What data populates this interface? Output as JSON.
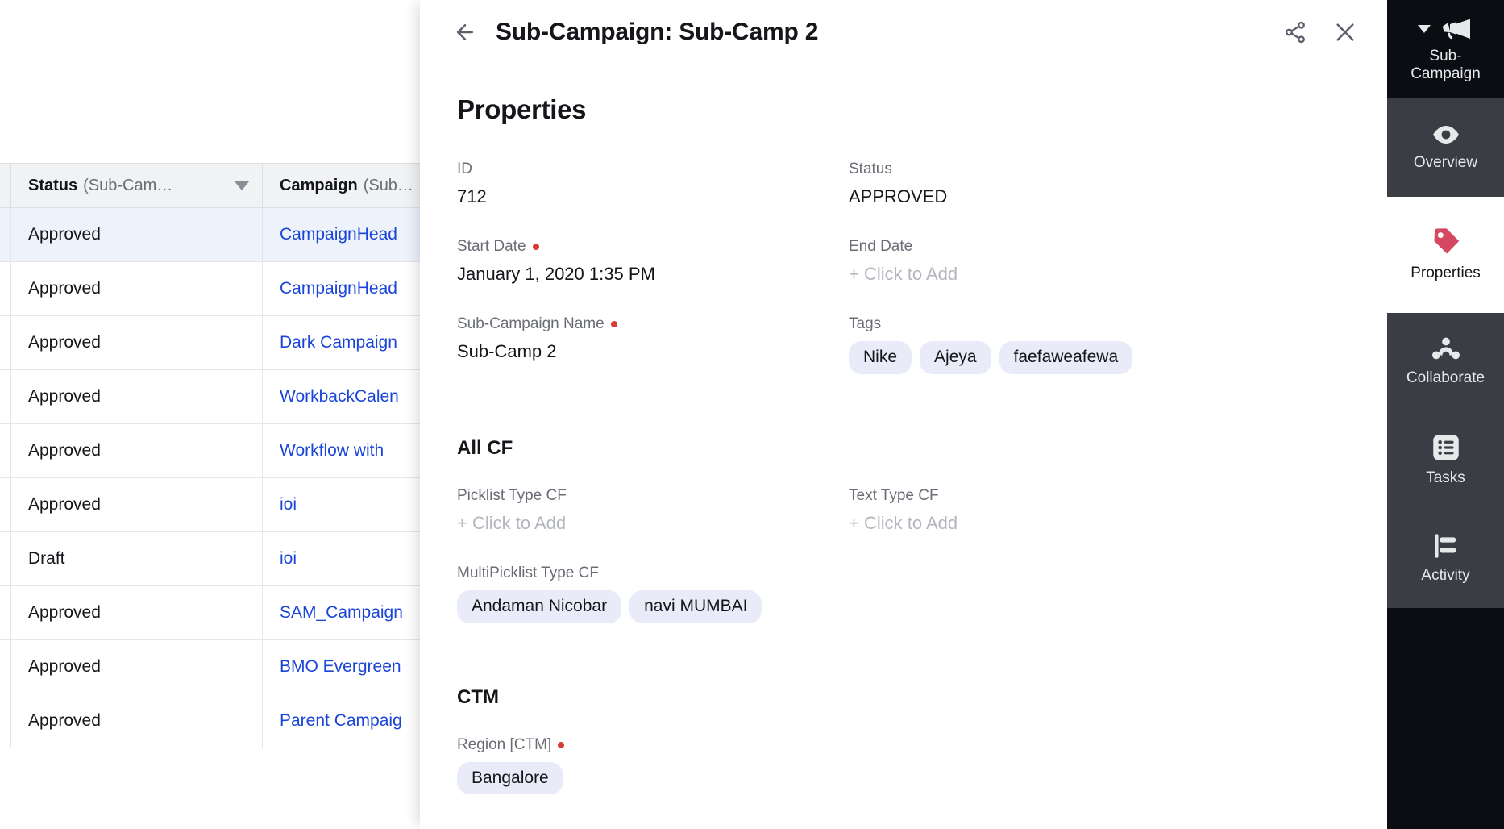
{
  "table": {
    "columns": [
      {
        "name": "Status",
        "qualifier": "(Sub-Cam…",
        "has_sort_caret": true
      },
      {
        "name": "Campaign",
        "qualifier": "(Sub…",
        "has_sort_caret": false
      }
    ],
    "rows": [
      {
        "status": "Approved",
        "campaign": "CampaignHead",
        "selected": true
      },
      {
        "status": "Approved",
        "campaign": "CampaignHead",
        "selected": false
      },
      {
        "status": "Approved",
        "campaign": "Dark Campaign",
        "selected": false
      },
      {
        "status": "Approved",
        "campaign": "WorkbackCalen",
        "selected": false
      },
      {
        "status": "Approved",
        "campaign": "Workflow with ",
        "selected": false
      },
      {
        "status": "Approved",
        "campaign": "ioi",
        "selected": false
      },
      {
        "status": "Draft",
        "campaign": "ioi",
        "selected": false
      },
      {
        "status": "Approved",
        "campaign": "SAM_Campaign",
        "selected": false
      },
      {
        "status": "Approved",
        "campaign": "BMO Evergreen",
        "selected": false
      },
      {
        "status": "Approved",
        "campaign": "Parent Campaig",
        "selected": false
      }
    ]
  },
  "panel": {
    "back_icon": "arrow-left-icon",
    "title": "Sub-Campaign: Sub-Camp 2",
    "share_icon": "share-icon",
    "close_icon": "close-icon",
    "sections": {
      "properties": {
        "heading": "Properties",
        "fields": {
          "id": {
            "label": "ID",
            "value": "712",
            "required": false
          },
          "status": {
            "label": "Status",
            "value": "APPROVED",
            "required": false
          },
          "start_date": {
            "label": "Start Date",
            "value": "January 1, 2020 1:35 PM",
            "required": true
          },
          "end_date": {
            "label": "End Date",
            "value": "+ Click to Add",
            "required": false,
            "empty": true
          },
          "sub_campaign_name": {
            "label": "Sub-Campaign Name",
            "value": "Sub-Camp 2",
            "required": true
          },
          "tags": {
            "label": "Tags",
            "required": false,
            "pills": [
              "Nike",
              "Ajeya",
              "faefaweafewa"
            ]
          }
        }
      },
      "all_cf": {
        "heading": "All CF",
        "fields": {
          "picklist": {
            "label": "Picklist Type CF",
            "value": "+ Click to Add",
            "required": false,
            "empty": true
          },
          "text": {
            "label": "Text Type CF",
            "value": "+ Click to Add",
            "required": false,
            "empty": true
          },
          "multipicklist": {
            "label": "MultiPicklist Type CF",
            "required": false,
            "pills": [
              "Andaman Nicobar",
              "navi MUMBAI"
            ]
          }
        }
      },
      "ctm": {
        "heading": "CTM",
        "fields": {
          "region": {
            "label": "Region [CTM]",
            "required": true,
            "pills": [
              "Bangalore"
            ]
          }
        }
      }
    }
  },
  "rail": {
    "items": [
      {
        "label": "Sub-\nCampaign",
        "icon": "megaphone-icon",
        "state": "brand",
        "caret": true
      },
      {
        "label": "Overview",
        "icon": "eye-icon",
        "state": "dark",
        "caret": false
      },
      {
        "label": "Properties",
        "icon": "tag-icon",
        "state": "active",
        "caret": false
      },
      {
        "label": "Collaborate",
        "icon": "people-icon",
        "state": "dark",
        "caret": false
      },
      {
        "label": "Tasks",
        "icon": "task-list-icon",
        "state": "dark",
        "caret": false
      },
      {
        "label": "Activity",
        "icon": "activity-icon",
        "state": "dark",
        "caret": false
      }
    ],
    "labels": {
      "sub_campaign_line1": "Sub-",
      "sub_campaign_line2": "Campaign",
      "overview": "Overview",
      "properties": "Properties",
      "collaborate": "Collaborate",
      "tasks": "Tasks",
      "activity": "Activity"
    }
  },
  "colors": {
    "accent_pink": "#d44861",
    "link_blue": "#1a45d8",
    "required_red": "#d93b35",
    "pill_bg": "#e9ecf8",
    "rail_dark": "#3b3d45",
    "rail_black": "#0c0d13",
    "row_selected": "#eef2fb"
  }
}
